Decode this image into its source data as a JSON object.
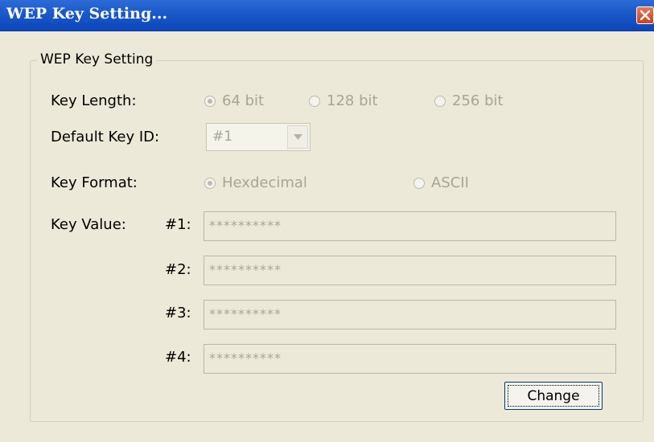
{
  "window": {
    "title": "WEP Key Setting...",
    "close_icon": "close-icon"
  },
  "group": {
    "legend": "WEP Key Setting"
  },
  "key_length": {
    "label": "Key Length:",
    "options": [
      "64 bit",
      "128 bit",
      "256 bit"
    ],
    "selected": "64 bit"
  },
  "default_key_id": {
    "label": "Default Key ID:",
    "value": "#1"
  },
  "key_format": {
    "label": "Key Format:",
    "options": [
      "Hexdecimal",
      "ASCII"
    ],
    "selected": "Hexdecimal"
  },
  "key_value": {
    "label": "Key Value:",
    "keys": [
      {
        "id": "#1:",
        "value": "**********"
      },
      {
        "id": "#2:",
        "value": "**********"
      },
      {
        "id": "#3:",
        "value": "**********"
      },
      {
        "id": "#4:",
        "value": "**********"
      }
    ]
  },
  "buttons": {
    "change": "Change"
  },
  "colors": {
    "titlebar": "#1a58c9",
    "background": "#ece9d8",
    "disabled_text": "#a9a596"
  }
}
